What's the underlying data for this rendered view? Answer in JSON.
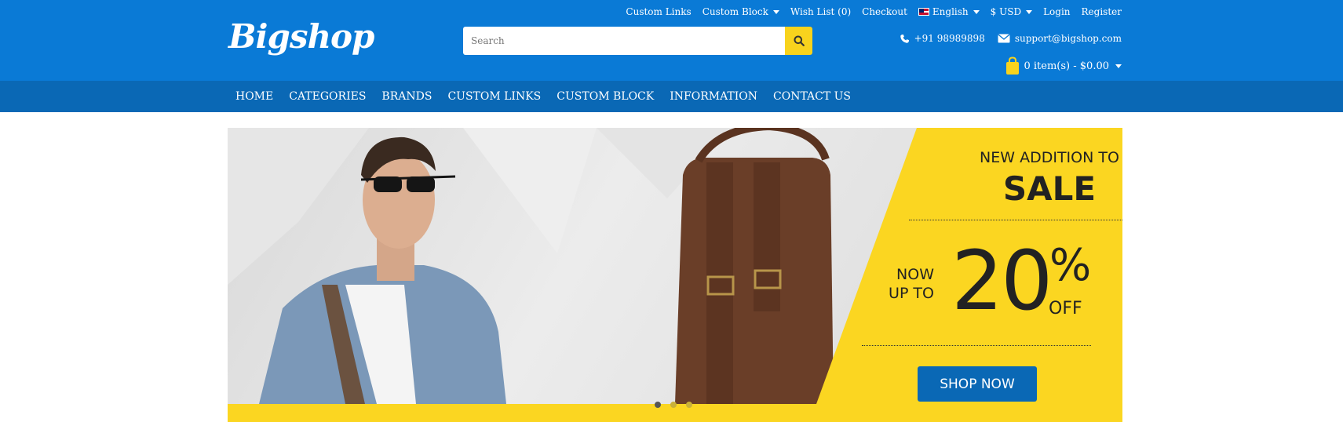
{
  "topbar": {
    "custom_links": "Custom Links",
    "custom_block": "Custom Block",
    "wishlist": "Wish List (0)",
    "checkout": "Checkout",
    "language": "English",
    "currency": "$ USD",
    "login": "Login",
    "register": "Register"
  },
  "brand": {
    "logo_text": "Bigshop"
  },
  "search": {
    "placeholder": "Search",
    "icon": "search-icon"
  },
  "contact": {
    "phone": "+91 98989898",
    "email": "support@bigshop.com"
  },
  "cart": {
    "summary": "0 item(s) - $0.00"
  },
  "nav": {
    "items": [
      {
        "label": "HOME"
      },
      {
        "label": "CATEGORIES"
      },
      {
        "label": "BRANDS"
      },
      {
        "label": "CUSTOM LINKS"
      },
      {
        "label": "CUSTOM BLOCK"
      },
      {
        "label": "INFORMATION"
      },
      {
        "label": "CONTACT US"
      }
    ]
  },
  "banner": {
    "headline": "NEW ADDITION TO",
    "sale": "SALE",
    "now": "NOW",
    "up_to": "UP TO",
    "percent": "20",
    "percent_sign": "%",
    "off": "OFF",
    "cta": "SHOP NOW",
    "slides_total": 3,
    "active_slide": 1
  },
  "colors": {
    "header_blue": "#0a7ad6",
    "nav_blue": "#0a68b5",
    "accent_yellow": "#fbd621"
  }
}
